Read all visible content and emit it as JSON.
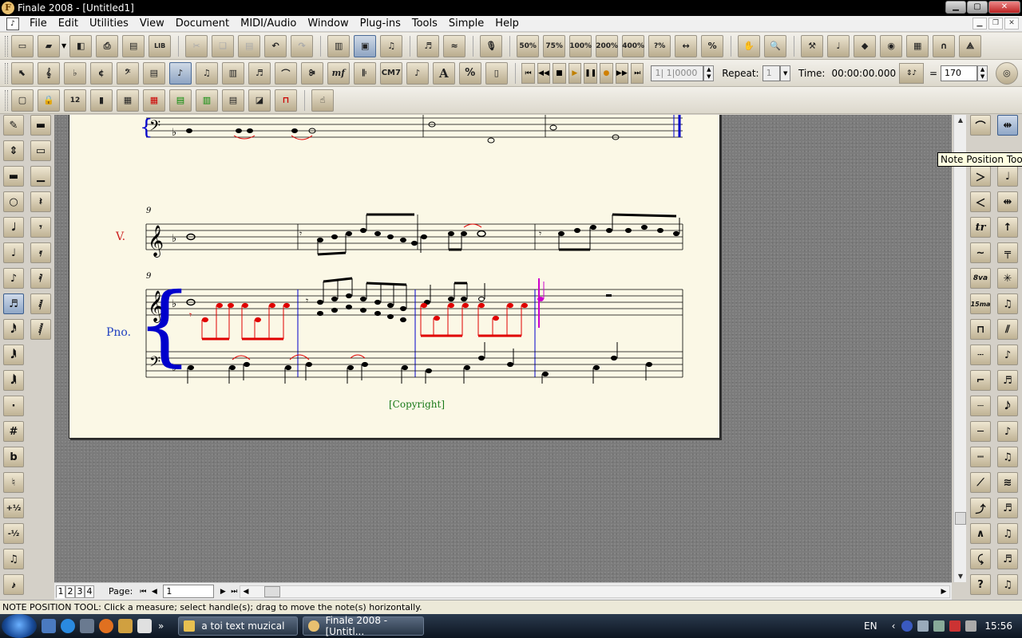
{
  "window": {
    "title": "Finale 2008 - [Untitled1]",
    "app_icon": "F"
  },
  "menu": {
    "items": [
      "File",
      "Edit",
      "Utilities",
      "View",
      "Document",
      "MIDI/Audio",
      "Window",
      "Plug-ins",
      "Tools",
      "Simple",
      "Help"
    ]
  },
  "toolbar1": {
    "zoom_labels": [
      "50%",
      "75%",
      "100%",
      "200%",
      "400%",
      "?%"
    ]
  },
  "toolbar2": {
    "counter": "1| 1|0000",
    "repeat_label": "Repeat:",
    "repeat_value": "1",
    "time_label": "Time:",
    "time_value": "00:00:00.000",
    "equals": "=",
    "tempo": "170",
    "chord_label": "CM7",
    "text_tool": "A",
    "pct": "%"
  },
  "toolbar3": {
    "staff_numbers": "12"
  },
  "left_palette": {
    "accidentals": [
      "#",
      "b",
      "♮",
      "+½",
      "-½"
    ]
  },
  "right_palette": {
    "octave_labels": [
      "8va",
      "15ma"
    ],
    "trill": "tr"
  },
  "tooltip": "Note Position Tool",
  "score": {
    "measure_number": "9",
    "violin_label": "V.",
    "piano_label": "Pno.",
    "copyright": "[Copyright]"
  },
  "bottom_bar": {
    "page_tabs": [
      "1",
      "2",
      "3",
      "4"
    ],
    "page_label": "Page:",
    "page_value": "1"
  },
  "status_bar": "NOTE POSITION TOOL: Click a measure; select handle(s); drag to move the note(s) horizontally.",
  "taskbar": {
    "tasks": [
      "a toi text muzical",
      "Finale 2008 - [Untitl..."
    ],
    "language": "EN",
    "clock": "15:56",
    "more": "»"
  },
  "colors": {
    "page": "#fbf8e6",
    "selected_notes": "#e00000",
    "selected_bar": "#0000cc",
    "cursor": "#cc00cc",
    "staff_label": "#cc2020",
    "piano_label": "#2040c0",
    "copyright": "#1a7a1a"
  }
}
